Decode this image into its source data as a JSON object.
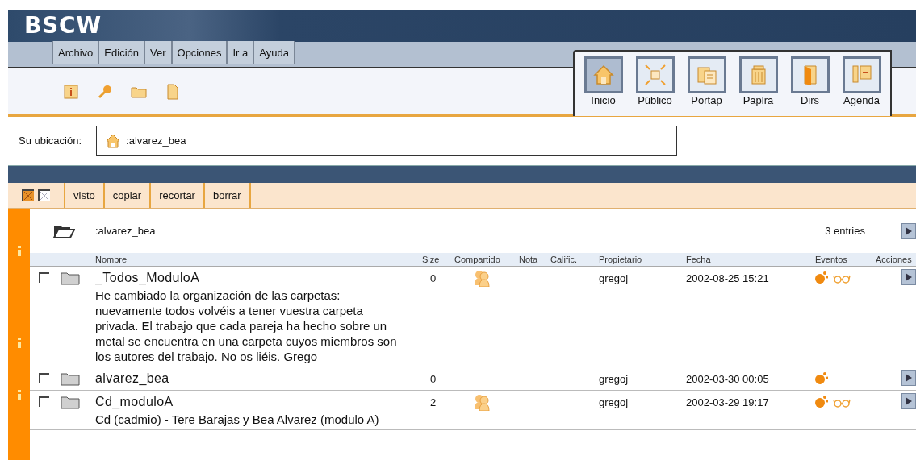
{
  "logo": "BSCW",
  "menu": [
    "Archivo",
    "Edición",
    "Ver",
    "Opciones",
    "Ir a",
    "Ayuda"
  ],
  "toolbar": [
    {
      "kind": "info"
    },
    {
      "kind": "key"
    },
    {
      "kind": "folder"
    },
    {
      "kind": "document"
    }
  ],
  "nav": [
    {
      "label": "Inicio",
      "kind": "home",
      "selected": true
    },
    {
      "label": "Público",
      "kind": "public",
      "selected": false
    },
    {
      "label": "Portap",
      "kind": "briefcase",
      "selected": false
    },
    {
      "label": "Paplra",
      "kind": "trash",
      "selected": false
    },
    {
      "label": "Dirs",
      "kind": "book",
      "selected": false
    },
    {
      "label": "Agenda",
      "kind": "agenda",
      "selected": false
    }
  ],
  "location": {
    "label": "Su ubicación:",
    "path": ":alvarez_bea"
  },
  "selection_tools": [
    {
      "kind": "select-all",
      "checked": true
    },
    {
      "kind": "deselect",
      "checked": false
    }
  ],
  "actions": [
    "visto",
    "copiar",
    "recortar",
    "borrar"
  ],
  "folder": {
    "name": ":alvarez_bea",
    "count": "3 entries"
  },
  "columns": [
    "Nombre",
    "Size",
    "Compartido",
    "Nota",
    "Calific.",
    "Propietario",
    "Fecha",
    "Eventos",
    "Acciones"
  ],
  "rows": [
    {
      "name": "_Todos_ModuloA",
      "description": "He cambiado la organización de las carpetas: nuevamente todos volvéis a tener vuestra carpeta privada. El trabajo que cada pareja ha hecho sobre un metal se encuentra en una carpeta cuyos miembros son los autores del trabajo. No os liéis. Grego",
      "size": "0",
      "shared": true,
      "owner": "gregoj",
      "date": "2002-08-25 15:21",
      "events": {
        "new": true,
        "read": true
      },
      "checked": false
    },
    {
      "name": "alvarez_bea",
      "size": "0",
      "shared": false,
      "owner": "gregoj",
      "date": "2002-03-30 00:05",
      "events": {
        "new": true,
        "read": false
      },
      "checked": false
    },
    {
      "name": "Cd_moduloA",
      "description": "Cd (cadmio) - Tere Barajas y Bea Alvarez (modulo A)",
      "size": "2",
      "shared": true,
      "owner": "gregoj",
      "date": "2002-03-29 19:17",
      "events": {
        "new": true,
        "read": true
      },
      "checked": false
    }
  ]
}
